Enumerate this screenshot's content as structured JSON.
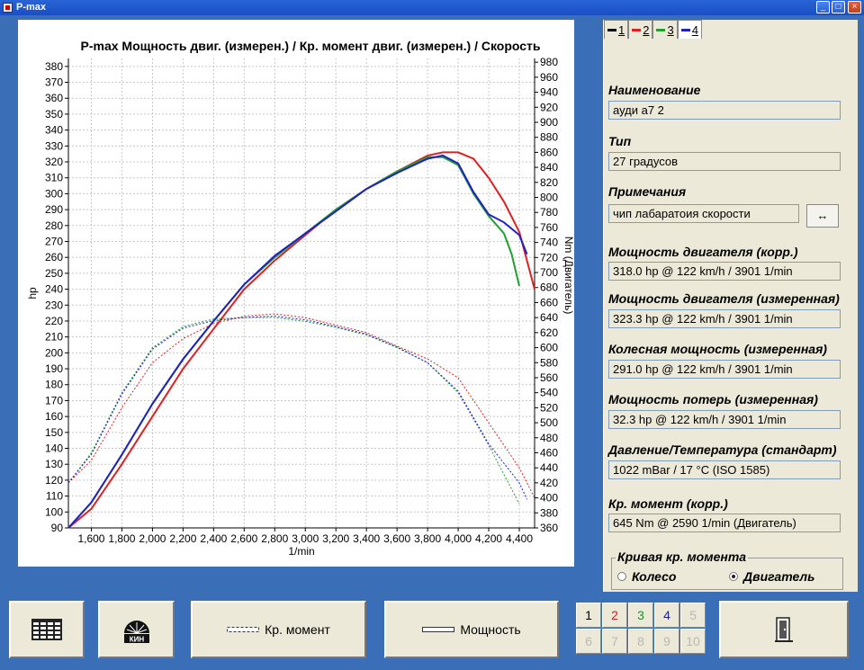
{
  "window": {
    "title": "P-max"
  },
  "chart_data": {
    "type": "line",
    "title": "P-max Мощность двиг. (измерен.) / Кр. момент двиг. (измерен.) / Скорость",
    "xlabel": "1/min",
    "ylabel": "hp",
    "y2label": "Nm (Двигатель)",
    "xlim": [
      1450,
      4500
    ],
    "ylim": [
      90,
      385
    ],
    "y2lim": [
      360,
      985
    ],
    "x_ticks": [
      "1,600",
      "1,800",
      "2,000",
      "2,200",
      "2,400",
      "2,600",
      "2,800",
      "3,000",
      "3,200",
      "3,400",
      "3,600",
      "3,800",
      "4,000",
      "4,200",
      "4,400"
    ],
    "y_ticks": [
      "90",
      "100",
      "110",
      "120",
      "130",
      "140",
      "150",
      "160",
      "170",
      "180",
      "190",
      "200",
      "210",
      "220",
      "230",
      "240",
      "250",
      "260",
      "270",
      "280",
      "290",
      "300",
      "310",
      "320",
      "330",
      "340",
      "350",
      "360",
      "370",
      "380"
    ],
    "y2_ticks": [
      "360",
      "380",
      "400",
      "420",
      "440",
      "460",
      "480",
      "500",
      "520",
      "540",
      "560",
      "580",
      "600",
      "620",
      "640",
      "660",
      "680",
      "700",
      "720",
      "740",
      "760",
      "780",
      "800",
      "820",
      "840",
      "860",
      "880",
      "900",
      "920",
      "940",
      "960",
      "980"
    ],
    "grid": true,
    "series": [
      {
        "color": "#e02020",
        "axis": "y",
        "style": "solid",
        "x": [
          1450,
          1600,
          1800,
          2000,
          2200,
          2400,
          2600,
          2800,
          3000,
          3200,
          3400,
          3600,
          3800,
          3900,
          4000,
          4100,
          4200,
          4300,
          4400,
          4500
        ],
        "values": [
          90,
          102,
          130,
          160,
          190,
          215,
          240,
          258,
          274,
          290,
          303,
          314,
          324,
          326,
          326,
          322,
          310,
          295,
          276,
          240
        ]
      },
      {
        "color": "#20a030",
        "axis": "y",
        "style": "solid",
        "x": [
          1450,
          1600,
          1800,
          2000,
          2200,
          2400,
          2600,
          2800,
          3000,
          3200,
          3400,
          3600,
          3800,
          3900,
          4000,
          4100,
          4200,
          4300,
          4350,
          4400
        ],
        "values": [
          90,
          106,
          136,
          168,
          196,
          220,
          243,
          260,
          275,
          290,
          303,
          314,
          323,
          323,
          318,
          300,
          286,
          275,
          262,
          242
        ]
      },
      {
        "color": "#2020c8",
        "axis": "y",
        "style": "solid",
        "x": [
          1450,
          1600,
          1800,
          2000,
          2200,
          2400,
          2600,
          2800,
          3000,
          3200,
          3400,
          3600,
          3800,
          3900,
          4000,
          4100,
          4200,
          4300,
          4400,
          4450
        ],
        "values": [
          90,
          106,
          136,
          168,
          196,
          220,
          243,
          261,
          275,
          289,
          303,
          313,
          322,
          324,
          319,
          301,
          287,
          282,
          274,
          262
        ]
      },
      {
        "color": "#e02020",
        "axis": "y2",
        "style": "dotted",
        "x": [
          1450,
          1600,
          1800,
          2000,
          2200,
          2400,
          2600,
          2800,
          3000,
          3200,
          3400,
          3600,
          3800,
          4000,
          4200,
          4400,
          4500
        ],
        "values": [
          420,
          450,
          520,
          580,
          612,
          632,
          642,
          645,
          640,
          630,
          620,
          602,
          585,
          560,
          500,
          440,
          400
        ]
      },
      {
        "color": "#20a030",
        "axis": "y2",
        "style": "dotted",
        "x": [
          1450,
          1600,
          1800,
          2000,
          2200,
          2400,
          2600,
          2800,
          3000,
          3200,
          3400,
          3600,
          3800,
          4000,
          4200,
          4400
        ],
        "values": [
          420,
          460,
          540,
          600,
          628,
          638,
          640,
          640,
          635,
          627,
          617,
          600,
          580,
          540,
          470,
          392
        ]
      },
      {
        "color": "#2020c8",
        "axis": "y2",
        "style": "dotted",
        "x": [
          1450,
          1600,
          1800,
          2000,
          2200,
          2400,
          2600,
          2800,
          3000,
          3200,
          3400,
          3600,
          3800,
          4000,
          4200,
          4400,
          4450
        ],
        "values": [
          420,
          458,
          538,
          598,
          626,
          636,
          640,
          642,
          637,
          628,
          618,
          601,
          580,
          542,
          472,
          420,
          398
        ]
      }
    ]
  },
  "tabs": [
    {
      "num": "1",
      "color": "#000000"
    },
    {
      "num": "2",
      "color": "#e02020"
    },
    {
      "num": "3",
      "color": "#20a030"
    },
    {
      "num": "4",
      "color": "#2020c8"
    }
  ],
  "info": {
    "name_label": "Наименование",
    "name_value": "ауди а7  2",
    "type_label": "Тип",
    "type_value": "27 градусов",
    "notes_label": "Примечания",
    "notes_value": "чип лабаратоия скорости",
    "swap_icon": "↔",
    "power_corr_label": "Мощность двигателя (корр.)",
    "power_corr_value": "318.0 hp @ 122 km/h / 3901 1/min",
    "power_meas_label": "Мощность двигателя (измеренная)",
    "power_meas_value": "323.3 hp @ 122 km/h / 3901 1/min",
    "wheel_label": "Колесная мощность (измеренная)",
    "wheel_value": "291.0 hp @ 122 km/h / 3901 1/min",
    "loss_label": "Мощность потерь (измеренная)",
    "loss_value": "32.3 hp @ 122 km/h / 3901 1/min",
    "pressure_label": "Давление/Температура (стандарт)",
    "pressure_value": "1022 mBar / 17 °C (ISO 1585)",
    "torque_label": "Кр. момент (корр.)",
    "torque_value": "645 Nm @ 2590 1/min (Двигатель)",
    "torque_curve_label": "Кривая кр. момента",
    "radio_wheel": "Колесо",
    "radio_engine": "Двигатель"
  },
  "bottom": {
    "torque_btn": "Кр. момент",
    "power_btn": "Мощность",
    "logo_text": "КИН",
    "numbers": [
      {
        "n": "1",
        "color": "#000000"
      },
      {
        "n": "2",
        "color": "#d02020"
      },
      {
        "n": "3",
        "color": "#209030"
      },
      {
        "n": "4",
        "color": "#20208a"
      },
      {
        "n": "5",
        "color": "#b8b8b8"
      },
      {
        "n": "6",
        "color": "#b8b8b8"
      },
      {
        "n": "7",
        "color": "#b8b8b8"
      },
      {
        "n": "8",
        "color": "#b8b8b8"
      },
      {
        "n": "9",
        "color": "#b8b8b8"
      },
      {
        "n": "10",
        "color": "#b8b8b8"
      }
    ]
  }
}
